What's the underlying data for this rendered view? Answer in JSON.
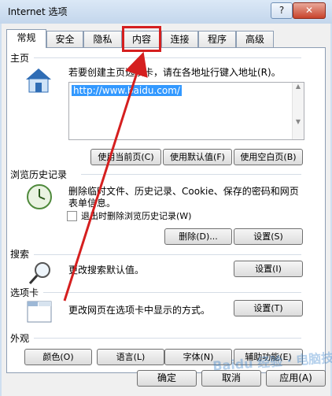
{
  "window": {
    "title": "Internet 选项",
    "help_label": "?",
    "close_label": "✕"
  },
  "tabs": [
    "常规",
    "安全",
    "隐私",
    "内容",
    "连接",
    "程序",
    "高级"
  ],
  "homepage": {
    "heading": "主页",
    "description": "若要创建主页选项卡，请在各地址行键入地址(R)。",
    "url": "http://www.baidu.com/",
    "buttons": [
      "使用当前页(C)",
      "使用默认值(F)",
      "使用空白页(B)"
    ]
  },
  "history": {
    "heading": "浏览历史记录",
    "description_line1": "删除临时文件、历史记录、Cookie、保存的密码和网页",
    "description_line2": "表单信息。",
    "checkbox_label": "退出时删除浏览历史记录(W)",
    "delete_button": "删除(D)...",
    "settings_button": "设置(S)"
  },
  "search": {
    "heading": "搜索",
    "description": "更改搜索默认值。",
    "settings_button": "设置(I)"
  },
  "tabsection": {
    "heading": "选项卡",
    "description": "更改网页在选项卡中显示的方式。",
    "settings_button": "设置(T)"
  },
  "appearance": {
    "heading": "外观",
    "buttons": [
      "颜色(O)",
      "语言(L)",
      "字体(N)",
      "辅助功能(E)"
    ]
  },
  "footer": {
    "ok": "确定",
    "cancel": "取消",
    "apply": "应用(A)"
  },
  "watermark": "Baidu 经验 · 电脑技术网",
  "colors": {
    "annotation": "#d51f1f",
    "selection": "#3399ff"
  }
}
